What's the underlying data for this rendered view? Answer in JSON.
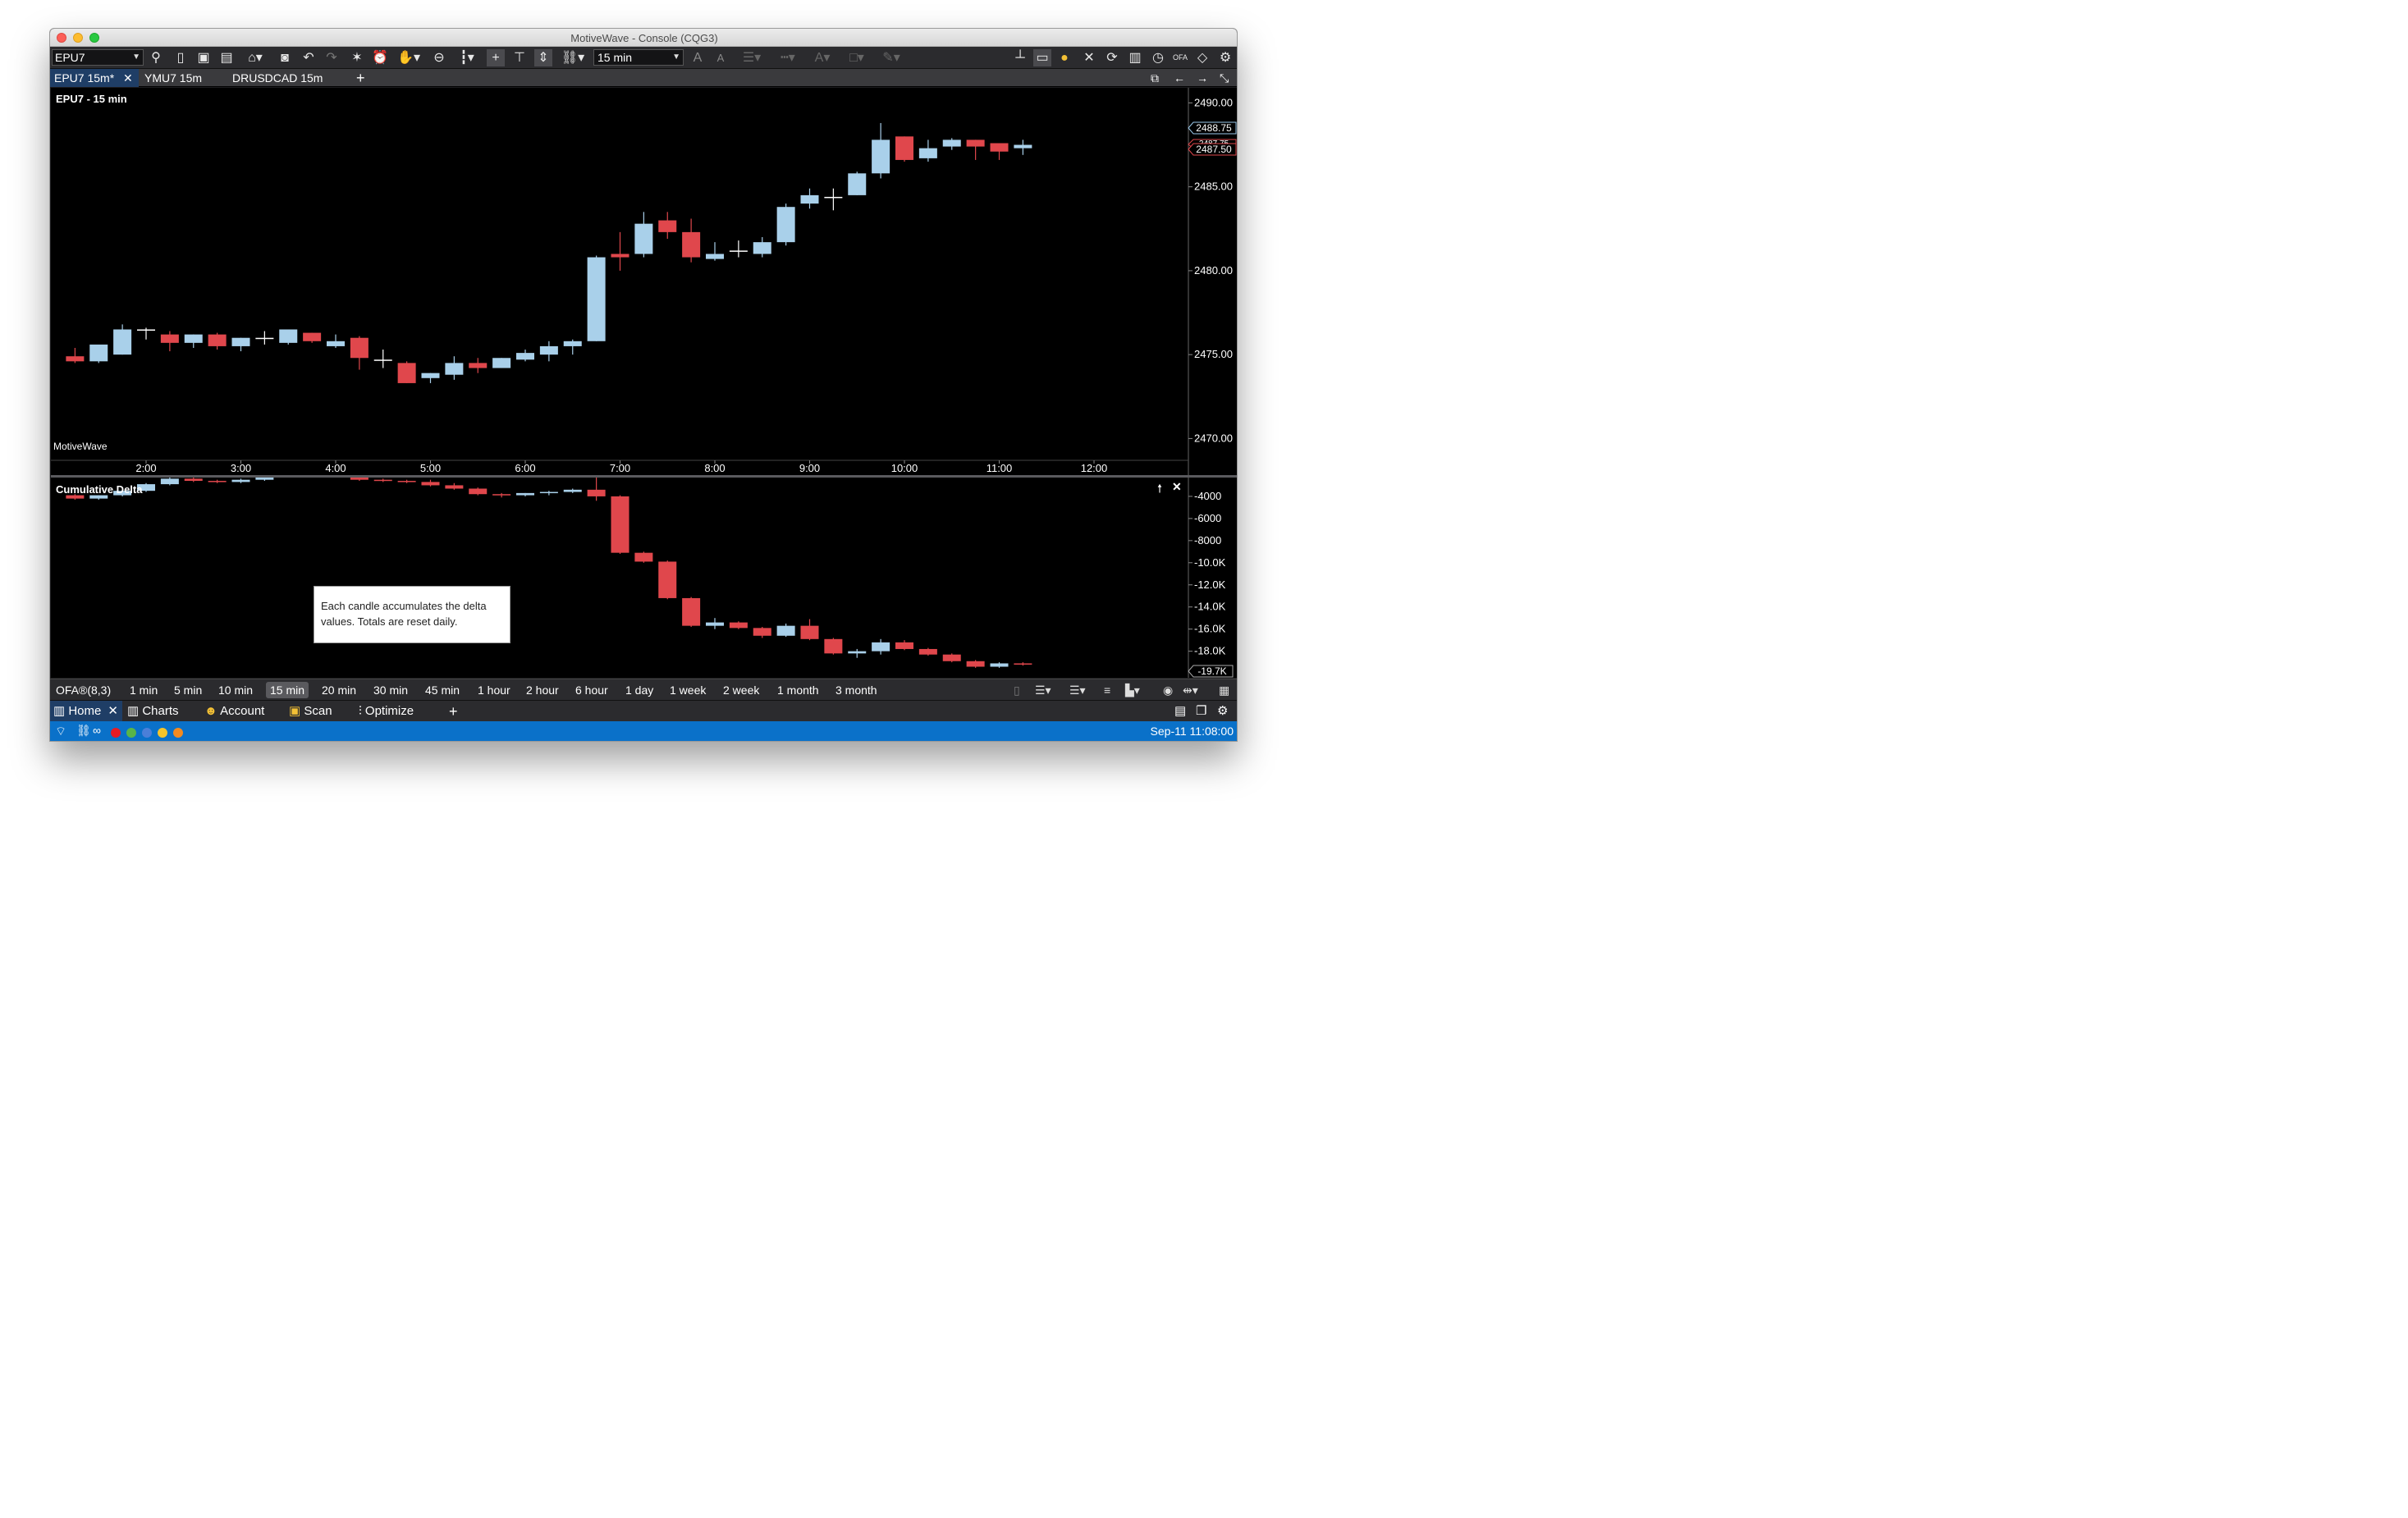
{
  "window": {
    "title": "MotiveWave - Console (CQG3)"
  },
  "toolbar": {
    "symbol": "EPU7",
    "timeframe": "15 min"
  },
  "tabs": [
    {
      "label": "EPU7 15m*",
      "active": true
    },
    {
      "label": "YMU7 15m"
    },
    {
      "label": "DRUSDCAD 15m"
    }
  ],
  "price_panel": {
    "title": "EPU7 - 15 min",
    "watermark": "MotiveWave",
    "last_price_tag": "2488.75",
    "hidden_price_tag": "2487.75",
    "current_price_tag": "2487.50"
  },
  "delta_panel": {
    "title": "Cumulative Delta",
    "last_value_tag": "-19.7K"
  },
  "annotation": {
    "text": "Each candle accumulates the delta values.  Totals are reset daily."
  },
  "timeframes": {
    "study": "OFA®(8,3)",
    "items": [
      "1 min",
      "5 min",
      "10 min",
      "15 min",
      "20 min",
      "30 min",
      "45 min",
      "1 hour",
      "2 hour",
      "6 hour",
      "1 day",
      "1 week",
      "2 week",
      "1 month",
      "3 month"
    ],
    "selected": "15 min"
  },
  "nav": {
    "home": "Home",
    "charts": "Charts",
    "account": "Account",
    "scan": "Scan",
    "optimize": "Optimize"
  },
  "status": {
    "clock": "Sep-11 11:08:00"
  },
  "colors": {
    "up": "#a9d0ea",
    "down": "#e0474c",
    "status": "#0a71c9",
    "active_tab": "#1f3e66"
  },
  "chart_data": [
    {
      "type": "candlestick",
      "title": "EPU7 - 15 min",
      "x_ticks": [
        "2:00",
        "3:00",
        "4:00",
        "5:00",
        "6:00",
        "7:00",
        "8:00",
        "9:00",
        "10:00",
        "11:00",
        "12:00"
      ],
      "y_ticks": [
        "2490.00",
        "2485.00",
        "2480.00",
        "2475.00",
        "2470.00"
      ],
      "ylim": [
        2468.7,
        2490.9
      ],
      "interval": "15 min",
      "candles": [
        {
          "t": "1:15",
          "o": 2474.9,
          "h": 2475.4,
          "l": 2474.5,
          "c": 2474.6
        },
        {
          "t": "1:30",
          "o": 2474.6,
          "h": 2475.2,
          "l": 2474.5,
          "c": 2475.6
        },
        {
          "t": "1:45",
          "o": 2475.0,
          "h": 2476.8,
          "l": 2475.0,
          "c": 2476.5
        },
        {
          "t": "2:00",
          "o": 2476.5,
          "h": 2476.6,
          "l": 2475.9,
          "c": 2476.5
        },
        {
          "t": "2:15",
          "o": 2476.2,
          "h": 2476.4,
          "l": 2475.2,
          "c": 2475.7
        },
        {
          "t": "2:30",
          "o": 2475.7,
          "h": 2476.2,
          "l": 2475.4,
          "c": 2476.2
        },
        {
          "t": "2:45",
          "o": 2476.2,
          "h": 2476.3,
          "l": 2475.3,
          "c": 2475.5
        },
        {
          "t": "3:00",
          "o": 2475.5,
          "h": 2476.0,
          "l": 2475.2,
          "c": 2476.0
        },
        {
          "t": "3:15",
          "o": 2476.0,
          "h": 2476.4,
          "l": 2475.6,
          "c": 2476.0
        },
        {
          "t": "3:30",
          "o": 2475.7,
          "h": 2476.5,
          "l": 2475.6,
          "c": 2476.5
        },
        {
          "t": "3:45",
          "o": 2476.3,
          "h": 2476.3,
          "l": 2475.7,
          "c": 2475.8
        },
        {
          "t": "4:00",
          "o": 2475.5,
          "h": 2476.2,
          "l": 2475.4,
          "c": 2475.8
        },
        {
          "t": "4:15",
          "o": 2476.0,
          "h": 2476.1,
          "l": 2474.1,
          "c": 2474.8
        },
        {
          "t": "4:30",
          "o": 2474.7,
          "h": 2475.3,
          "l": 2474.2,
          "c": 2474.7
        },
        {
          "t": "4:45",
          "o": 2474.5,
          "h": 2474.6,
          "l": 2473.3,
          "c": 2473.3
        },
        {
          "t": "5:00",
          "o": 2473.6,
          "h": 2473.9,
          "l": 2473.3,
          "c": 2473.9
        },
        {
          "t": "5:15",
          "o": 2473.8,
          "h": 2474.9,
          "l": 2473.5,
          "c": 2474.5
        },
        {
          "t": "5:30",
          "o": 2474.5,
          "h": 2474.8,
          "l": 2473.9,
          "c": 2474.2
        },
        {
          "t": "5:45",
          "o": 2474.2,
          "h": 2474.8,
          "l": 2474.2,
          "c": 2474.8
        },
        {
          "t": "6:00",
          "o": 2474.7,
          "h": 2475.3,
          "l": 2474.6,
          "c": 2475.1
        },
        {
          "t": "6:15",
          "o": 2475.0,
          "h": 2475.8,
          "l": 2474.6,
          "c": 2475.5
        },
        {
          "t": "6:30",
          "o": 2475.5,
          "h": 2475.9,
          "l": 2475.0,
          "c": 2475.8
        },
        {
          "t": "6:45",
          "o": 2475.8,
          "h": 2480.9,
          "l": 2475.8,
          "c": 2480.8
        },
        {
          "t": "7:00",
          "o": 2481.0,
          "h": 2482.3,
          "l": 2480.0,
          "c": 2480.8
        },
        {
          "t": "7:15",
          "o": 2481.0,
          "h": 2483.5,
          "l": 2480.8,
          "c": 2482.8
        },
        {
          "t": "7:30",
          "o": 2483.0,
          "h": 2483.5,
          "l": 2481.9,
          "c": 2482.3
        },
        {
          "t": "7:45",
          "o": 2482.3,
          "h": 2483.1,
          "l": 2480.5,
          "c": 2480.8
        },
        {
          "t": "8:00",
          "o": 2480.7,
          "h": 2481.7,
          "l": 2480.6,
          "c": 2481.0
        },
        {
          "t": "8:15",
          "o": 2481.2,
          "h": 2481.8,
          "l": 2480.8,
          "c": 2481.2
        },
        {
          "t": "8:30",
          "o": 2481.0,
          "h": 2482.0,
          "l": 2480.8,
          "c": 2481.7
        },
        {
          "t": "8:45",
          "o": 2481.7,
          "h": 2484.0,
          "l": 2481.5,
          "c": 2483.8
        },
        {
          "t": "9:00",
          "o": 2484.0,
          "h": 2484.9,
          "l": 2483.7,
          "c": 2484.5
        },
        {
          "t": "9:15",
          "o": 2484.4,
          "h": 2484.9,
          "l": 2483.6,
          "c": 2484.4
        },
        {
          "t": "9:30",
          "o": 2484.5,
          "h": 2485.9,
          "l": 2484.5,
          "c": 2485.8
        },
        {
          "t": "9:45",
          "o": 2485.8,
          "h": 2488.8,
          "l": 2485.5,
          "c": 2487.8
        },
        {
          "t": "10:00",
          "o": 2488.0,
          "h": 2488.0,
          "l": 2486.5,
          "c": 2486.6
        },
        {
          "t": "10:15",
          "o": 2486.7,
          "h": 2487.8,
          "l": 2486.5,
          "c": 2487.3
        },
        {
          "t": "10:30",
          "o": 2487.4,
          "h": 2487.9,
          "l": 2487.2,
          "c": 2487.8
        },
        {
          "t": "10:45",
          "o": 2487.8,
          "h": 2487.8,
          "l": 2486.6,
          "c": 2487.4
        },
        {
          "t": "11:00",
          "o": 2487.6,
          "h": 2487.6,
          "l": 2486.6,
          "c": 2487.1
        },
        {
          "t": "11:15",
          "o": 2487.3,
          "h": 2487.8,
          "l": 2486.9,
          "c": 2487.5
        }
      ]
    },
    {
      "type": "candlestick",
      "title": "Cumulative Delta",
      "y_ticks": [
        "-4000",
        "-6000",
        "-8000",
        "-10.0K",
        "-12.0K",
        "-14.0K",
        "-16.0K",
        "-18.0K"
      ],
      "ylim": [
        -20400,
        -2300
      ],
      "candles": [
        {
          "t": "1:15",
          "o": -3900,
          "h": -3800,
          "l": -4300,
          "c": -4200
        },
        {
          "t": "1:30",
          "o": -4200,
          "h": -3900,
          "l": -4300,
          "c": -3900
        },
        {
          "t": "1:45",
          "o": -3900,
          "h": -3400,
          "l": -4000,
          "c": -3500
        },
        {
          "t": "2:00",
          "o": -3500,
          "h": -2800,
          "l": -3600,
          "c": -2900
        },
        {
          "t": "2:15",
          "o": -2900,
          "h": -2300,
          "l": -3000,
          "c": -2400
        },
        {
          "t": "2:30",
          "o": -2400,
          "h": -2200,
          "l": -2700,
          "c": -2600
        },
        {
          "t": "2:45",
          "o": -2600,
          "h": -2500,
          "l": -2800,
          "c": -2700
        },
        {
          "t": "3:00",
          "o": -2700,
          "h": -2400,
          "l": -2800,
          "c": -2500
        },
        {
          "t": "3:15",
          "o": -2500,
          "h": -1800,
          "l": -2600,
          "c": -1900
        },
        {
          "t": "3:30",
          "o": -1900,
          "h": -1600,
          "l": -2100,
          "c": -1800
        },
        {
          "t": "3:45",
          "o": -1800,
          "h": -1200,
          "l": -1900,
          "c": -1300
        },
        {
          "t": "4:00",
          "o": -1300,
          "h": -1100,
          "l": -1400,
          "c": -1200
        },
        {
          "t": "4:15",
          "o": -1200,
          "h": -1100,
          "l": -2600,
          "c": -2500
        },
        {
          "t": "4:30",
          "o": -2500,
          "h": -2400,
          "l": -2700,
          "c": -2600
        },
        {
          "t": "4:45",
          "o": -2600,
          "h": -2500,
          "l": -2800,
          "c": -2700
        },
        {
          "t": "5:00",
          "o": -2700,
          "h": -2500,
          "l": -3100,
          "c": -3000
        },
        {
          "t": "5:15",
          "o": -3000,
          "h": -2800,
          "l": -3400,
          "c": -3300
        },
        {
          "t": "5:30",
          "o": -3300,
          "h": -3200,
          "l": -3900,
          "c": -3800
        },
        {
          "t": "5:45",
          "o": -3800,
          "h": -3700,
          "l": -4100,
          "c": -3900
        },
        {
          "t": "6:00",
          "o": -3900,
          "h": -3700,
          "l": -4000,
          "c": -3700
        },
        {
          "t": "6:15",
          "o": -3700,
          "h": -3500,
          "l": -3900,
          "c": -3600
        },
        {
          "t": "6:30",
          "o": -3600,
          "h": -3300,
          "l": -3700,
          "c": -3400
        },
        {
          "t": "6:45",
          "o": -3400,
          "h": -1300,
          "l": -4400,
          "c": -4000
        },
        {
          "t": "7:00",
          "o": -4000,
          "h": -3900,
          "l": -9200,
          "c": -9100
        },
        {
          "t": "7:15",
          "o": -9100,
          "h": -9000,
          "l": -10000,
          "c": -9900
        },
        {
          "t": "7:30",
          "o": -9900,
          "h": -9800,
          "l": -13300,
          "c": -13200
        },
        {
          "t": "7:45",
          "o": -13200,
          "h": -13100,
          "l": -15800,
          "c": -15700
        },
        {
          "t": "8:00",
          "o": -15700,
          "h": -15000,
          "l": -16000,
          "c": -15400
        },
        {
          "t": "8:15",
          "o": -15400,
          "h": -15300,
          "l": -16000,
          "c": -15900
        },
        {
          "t": "8:30",
          "o": -15900,
          "h": -15800,
          "l": -16800,
          "c": -16600
        },
        {
          "t": "8:45",
          "o": -16600,
          "h": -15500,
          "l": -16700,
          "c": -15700
        },
        {
          "t": "9:00",
          "o": -15700,
          "h": -15100,
          "l": -17000,
          "c": -16900
        },
        {
          "t": "9:15",
          "o": -16900,
          "h": -16800,
          "l": -18300,
          "c": -18200
        },
        {
          "t": "9:30",
          "o": -18200,
          "h": -17800,
          "l": -18600,
          "c": -18000
        },
        {
          "t": "9:45",
          "o": -18000,
          "h": -16900,
          "l": -18300,
          "c": -17200
        },
        {
          "t": "10:00",
          "o": -17200,
          "h": -17000,
          "l": -17900,
          "c": -17800
        },
        {
          "t": "10:15",
          "o": -17800,
          "h": -17700,
          "l": -18400,
          "c": -18300
        },
        {
          "t": "10:30",
          "o": -18300,
          "h": -18200,
          "l": -19000,
          "c": -18900
        },
        {
          "t": "10:45",
          "o": -18900,
          "h": -18800,
          "l": -19500,
          "c": -19400
        },
        {
          "t": "11:00",
          "o": -19400,
          "h": -19000,
          "l": -19500,
          "c": -19100
        },
        {
          "t": "11:15",
          "o": -19100,
          "h": -19000,
          "l": -19300,
          "c": -19200
        }
      ]
    }
  ]
}
